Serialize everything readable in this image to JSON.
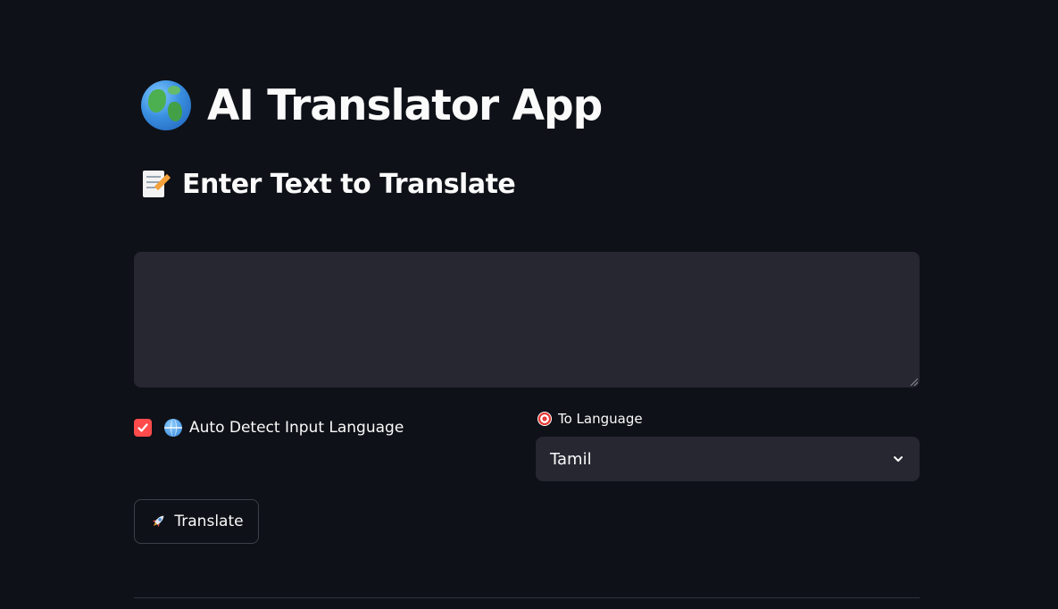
{
  "app": {
    "title": "AI Translator App",
    "title_icon": "globe-europe-africa-icon"
  },
  "section": {
    "subheader": "Enter Text to Translate",
    "subheader_icon": "memo-icon"
  },
  "input": {
    "value": "",
    "placeholder": ""
  },
  "auto_detect": {
    "label": "Auto Detect Input Language",
    "checked": true,
    "icon": "globe-with-meridians-icon"
  },
  "to_language": {
    "label": "To Language",
    "icon": "direct-hit-icon",
    "selected": "Tamil"
  },
  "translate_button": {
    "label": "Translate",
    "icon": "rocket-icon"
  },
  "colors": {
    "background": "#0e1117",
    "widget_background": "#262730",
    "accent": "#ff4b4b",
    "text": "#fafafa"
  }
}
